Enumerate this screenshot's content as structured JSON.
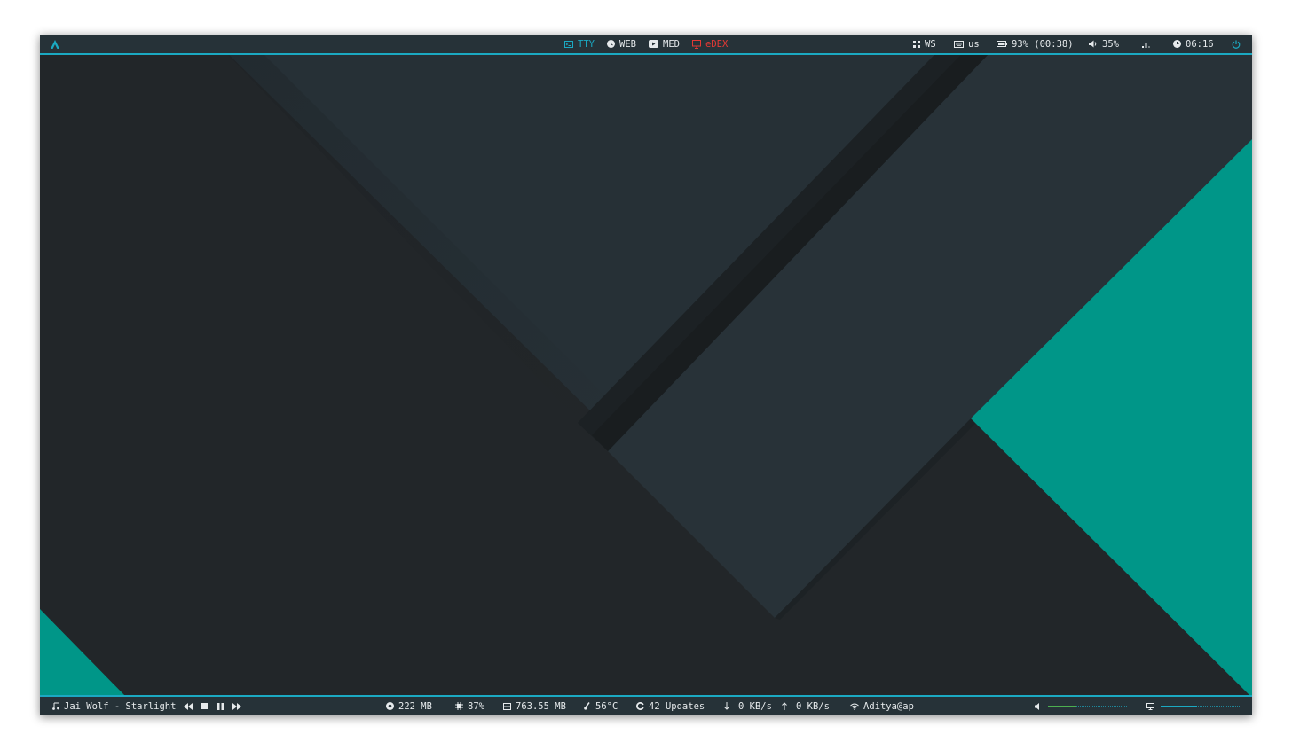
{
  "topbar": {
    "launcher_icon": "arch-logo-icon",
    "workspaces": [
      {
        "label": "TTY",
        "icon": "terminal-icon",
        "color": "#1ba9c2",
        "active": true
      },
      {
        "label": "WEB",
        "icon": "web-icon",
        "color": "#e6eaec"
      },
      {
        "label": "MED",
        "icon": "media-icon",
        "color": "#e6eaec"
      },
      {
        "label": "eDEX",
        "icon": "monitor-icon",
        "color": "#e53935"
      }
    ],
    "status": {
      "ws": "WS",
      "keyboard": "us",
      "battery": "93% (00:38)",
      "volume": "35%",
      "clock": "06:16"
    },
    "power_icon": "power-icon"
  },
  "bottombar": {
    "music": {
      "track": "Jai Wolf - Starlight"
    },
    "stats": {
      "memory": "222 MB",
      "cpu": "87%",
      "filesystem": "763.55 MB",
      "temperature": "56°C",
      "updates": "42 Updates",
      "download": "0 KB/s",
      "upload": "0 KB/s",
      "network": "Aditya@ap"
    },
    "volume_level": 0.35,
    "brightness_level": 0.45
  },
  "colors": {
    "accent": "#1ba9c2",
    "wallpaper_teal": "#009688",
    "bar_bg": "#263238",
    "alert": "#e53935",
    "volume_fill": "#4caf50"
  }
}
